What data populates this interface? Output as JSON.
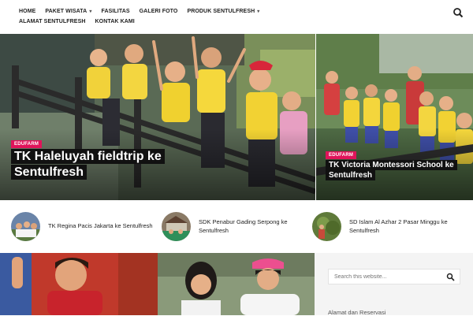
{
  "nav": {
    "row1": [
      {
        "label": "HOME",
        "dropdown": false
      },
      {
        "label": "PAKET WISATA",
        "dropdown": true
      },
      {
        "label": "FASILITAS",
        "dropdown": false
      },
      {
        "label": "GALERI FOTO",
        "dropdown": false
      },
      {
        "label": "PRODUK SENTULFRESH",
        "dropdown": true
      }
    ],
    "row2": [
      {
        "label": "ALAMAT SENTULFRESH",
        "dropdown": false
      },
      {
        "label": "KONTAK KAMI",
        "dropdown": false
      }
    ],
    "search_icon": "search-icon"
  },
  "hero": {
    "main": {
      "category": "EDUFARM",
      "title": "TK Haleluyah fieldtrip ke Sentulfresh"
    },
    "side": {
      "category": "EDUFARM",
      "title": "TK Victoria Montessori School ke Sentulfresh"
    }
  },
  "mini_posts": [
    {
      "title": "TK Regina Pacis Jakarta ke Sentulfresh"
    },
    {
      "title": "SDK Penabur Gading Serpong ke Sentulfresh"
    },
    {
      "title": "SD Islam Al Azhar 2 Pasar Minggu ke Sentulfresh"
    }
  ],
  "sidebar": {
    "search_placeholder": "Search this website...",
    "heading": "Alamat dan Reservasi"
  },
  "colors": {
    "accent": "#e0145a",
    "title_bg": "#111111"
  }
}
